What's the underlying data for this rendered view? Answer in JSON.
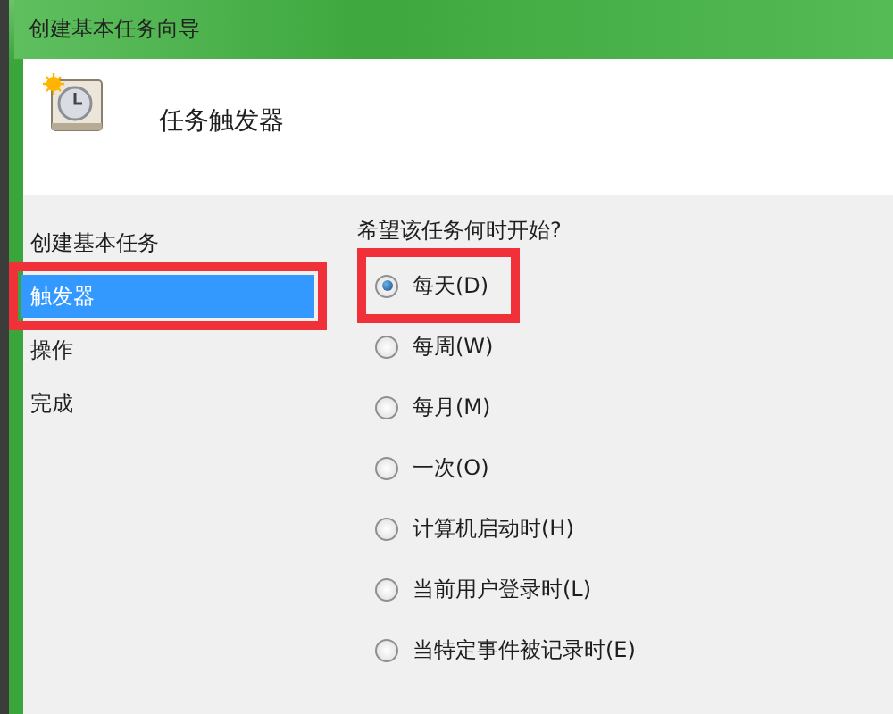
{
  "window": {
    "title": "创建基本任务向导"
  },
  "header": {
    "title": "任务触发器"
  },
  "sidebar": {
    "items": [
      {
        "label": "创建基本任务",
        "selected": false,
        "highlighted": false
      },
      {
        "label": "触发器",
        "selected": true,
        "highlighted": true
      },
      {
        "label": "操作",
        "selected": false,
        "highlighted": false
      },
      {
        "label": "完成",
        "selected": false,
        "highlighted": false
      }
    ]
  },
  "question": "希望该任务何时开始?",
  "options": [
    {
      "label": "每天(D)",
      "selected": true,
      "highlighted": true
    },
    {
      "label": "每周(W)",
      "selected": false,
      "highlighted": false
    },
    {
      "label": "每月(M)",
      "selected": false,
      "highlighted": false
    },
    {
      "label": "一次(O)",
      "selected": false,
      "highlighted": false
    },
    {
      "label": "计算机启动时(H)",
      "selected": false,
      "highlighted": false
    },
    {
      "label": "当前用户登录时(L)",
      "selected": false,
      "highlighted": false
    },
    {
      "label": "当特定事件被记录时(E)",
      "selected": false,
      "highlighted": false
    }
  ]
}
